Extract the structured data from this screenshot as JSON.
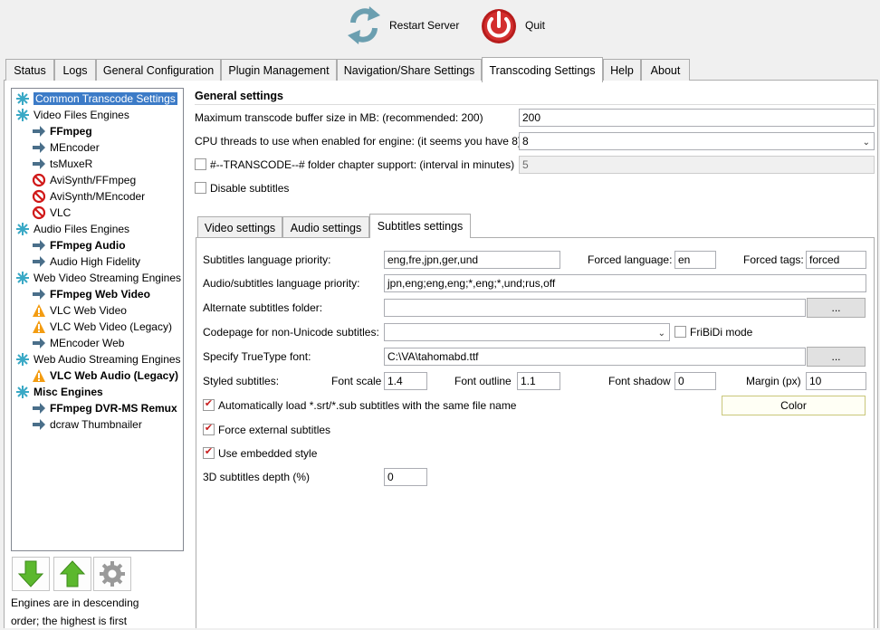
{
  "toolbar": {
    "restart_label": "Restart Server",
    "quit_label": "Quit"
  },
  "tabs": [
    "Status",
    "Logs",
    "General Configuration",
    "Plugin Management",
    "Navigation/Share Settings",
    "Transcoding Settings",
    "Help",
    "About"
  ],
  "active_tab": "Transcoding Settings",
  "tree": {
    "items": [
      {
        "label": "Common Transcode Settings",
        "icon": "snowflake-icon",
        "selected": true
      },
      {
        "label": "Video Files Engines",
        "icon": "snowflake-icon"
      },
      {
        "label": "FFmpeg",
        "icon": "arrow-right-icon",
        "bold": true
      },
      {
        "label": "MEncoder",
        "icon": "arrow-right-icon"
      },
      {
        "label": "tsMuxeR",
        "icon": "arrow-right-icon"
      },
      {
        "label": "AviSynth/FFmpeg",
        "icon": "no-entry-icon"
      },
      {
        "label": "AviSynth/MEncoder",
        "icon": "no-entry-icon"
      },
      {
        "label": "VLC",
        "icon": "no-entry-icon"
      },
      {
        "label": "Audio Files Engines",
        "icon": "snowflake-icon"
      },
      {
        "label": "FFmpeg Audio",
        "icon": "arrow-right-icon",
        "bold": true
      },
      {
        "label": "Audio High Fidelity",
        "icon": "arrow-right-icon"
      },
      {
        "label": "Web Video Streaming Engines",
        "icon": "snowflake-icon"
      },
      {
        "label": "FFmpeg Web Video",
        "icon": "arrow-right-icon",
        "bold": true
      },
      {
        "label": "VLC Web Video",
        "icon": "warning-icon"
      },
      {
        "label": "VLC Web Video (Legacy)",
        "icon": "warning-icon"
      },
      {
        "label": "MEncoder Web",
        "icon": "arrow-right-icon"
      },
      {
        "label": "Web Audio Streaming Engines",
        "icon": "snowflake-icon"
      },
      {
        "label": "VLC Web Audio (Legacy)",
        "icon": "warning-icon",
        "bold": true
      },
      {
        "label": "Misc Engines",
        "icon": "snowflake-icon",
        "bold": true
      },
      {
        "label": "FFmpeg DVR-MS Remux",
        "icon": "arrow-right-icon",
        "bold": true
      },
      {
        "label": "dcraw Thumbnailer",
        "icon": "arrow-right-icon"
      }
    ]
  },
  "engines_note": [
    "Engines are in descending",
    "order; the highest is first"
  ],
  "general": {
    "title": "General settings",
    "buffer_label": "Maximum transcode buffer size in MB: (recommended: 200)",
    "buffer_value": "200",
    "cpu_label": "CPU threads to use when enabled for engine: (it seems you have 8)",
    "cpu_value": "8",
    "chapter_label": "#--TRANSCODE--# folder chapter support: (interval in minutes)",
    "chapter_value": "5",
    "disable_subs_label": "Disable subtitles"
  },
  "subtabs": [
    "Video settings",
    "Audio settings",
    "Subtitles settings"
  ],
  "subtitles": {
    "lang_priority_label": "Subtitles language priority:",
    "lang_priority_value": "eng,fre,jpn,ger,und",
    "forced_lang_label": "Forced language:",
    "forced_lang_value": "en",
    "forced_tags_label": "Forced tags:",
    "forced_tags_value": "forced",
    "audio_sub_priority_label": "Audio/subtitles language priority:",
    "audio_sub_priority_value": "jpn,eng;eng,eng;*,eng;*,und;rus,off",
    "alt_folder_label": "Alternate subtitles folder:",
    "alt_folder_value": "",
    "browse_label": "...",
    "codepage_label": "Codepage for non-Unicode subtitles:",
    "codepage_value": "",
    "fribidi_label": "FriBiDi mode",
    "font_label": "Specify TrueType font:",
    "font_value": "C:\\VA\\tahomabd.ttf",
    "styled_label": "Styled subtitles:",
    "font_scale_label": "Font scale",
    "font_scale_value": "1.4",
    "font_outline_label": "Font outline",
    "font_outline_value": "1.1",
    "font_shadow_label": "Font shadow",
    "font_shadow_value": "0",
    "margin_label": "Margin (px)",
    "margin_value": "10",
    "autoload_label": "Automatically load *.srt/*.sub subtitles with the same file name",
    "color_label": "Color",
    "force_external_label": "Force external subtitles",
    "embedded_style_label": "Use embedded style",
    "depth_label": "3D subtitles depth (%)",
    "depth_value": "0"
  }
}
